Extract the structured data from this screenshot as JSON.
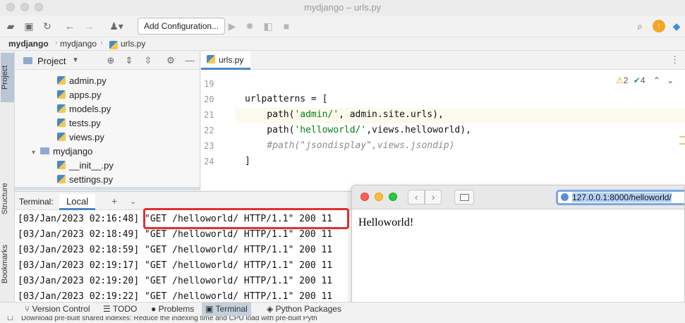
{
  "window": {
    "title": "mydjango – urls.py"
  },
  "toolbar": {
    "add_configuration": "Add Configuration..."
  },
  "breadcrumb": [
    "mydjango",
    "mydjango",
    "urls.py"
  ],
  "side_tabs": {
    "project": "Project",
    "structure": "Structure",
    "bookmarks": "Bookmarks"
  },
  "project_panel": {
    "title": "Project",
    "items": [
      {
        "label": "admin.py",
        "type": "file",
        "depth": 2
      },
      {
        "label": "apps.py",
        "type": "file",
        "depth": 2
      },
      {
        "label": "models.py",
        "type": "file",
        "depth": 2
      },
      {
        "label": "tests.py",
        "type": "file",
        "depth": 2
      },
      {
        "label": "views.py",
        "type": "file",
        "depth": 2
      },
      {
        "label": "mydjango",
        "type": "folder",
        "depth": 1
      },
      {
        "label": "__init__.py",
        "type": "file",
        "depth": 2
      },
      {
        "label": "settings.py",
        "type": "file",
        "depth": 2
      }
    ]
  },
  "editor": {
    "tab": "urls.py",
    "inspections": {
      "warnings": "2",
      "ok": "4"
    },
    "lines": [
      {
        "no": "19",
        "text": ""
      },
      {
        "no": "20",
        "text": "urlpatterns = ["
      },
      {
        "no": "21",
        "pre": "    path(",
        "str": "'admin/'",
        "post": ", admin.site.urls),"
      },
      {
        "no": "22",
        "pre": "    path(",
        "str": "'helloworld/'",
        "post": ",views.helloworld),"
      },
      {
        "no": "23",
        "comment": "    #path(\"jsondisplay\",views.jsondip)"
      },
      {
        "no": "24",
        "text": "]"
      }
    ]
  },
  "terminal": {
    "label": "Terminal:",
    "tab": "Local",
    "lines": [
      {
        "ts": "[03/Jan/2023 02:16:48]",
        "req": "\"GET /helloworld/ HTTP/1.1\" 200 11"
      },
      {
        "ts": "[03/Jan/2023 02:18:49]",
        "req": "\"GET /helloworld/ HTTP/1.1\" 200 11"
      },
      {
        "ts": "[03/Jan/2023 02:18:59]",
        "req": "\"GET /helloworld/ HTTP/1.1\" 200 11"
      },
      {
        "ts": "[03/Jan/2023 02:19:17]",
        "req": "\"GET /helloworld/ HTTP/1.1\" 200 11"
      },
      {
        "ts": "[03/Jan/2023 02:19:20]",
        "req": "\"GET /helloworld/ HTTP/1.1\" 200 11"
      },
      {
        "ts": "[03/Jan/2023 02:19:22]",
        "req": "\"GET /helloworld/ HTTP/1.1\" 200 11"
      }
    ]
  },
  "statusbar": {
    "items": [
      "Version Control",
      "TODO",
      "Problems",
      "Terminal",
      "Python Packages"
    ],
    "active": "Terminal",
    "message": "Download pre-built shared indexes: Reduce the indexing time and CPU load with pre-built Pyth"
  },
  "browser": {
    "url": "127.0.0.1:8000/helloworld/",
    "content": "Helloworld!"
  },
  "colors": {
    "accent": "#4a88c7",
    "highlight_box": "#e03030",
    "string": "#067d17",
    "comment": "#8c8c8c"
  }
}
